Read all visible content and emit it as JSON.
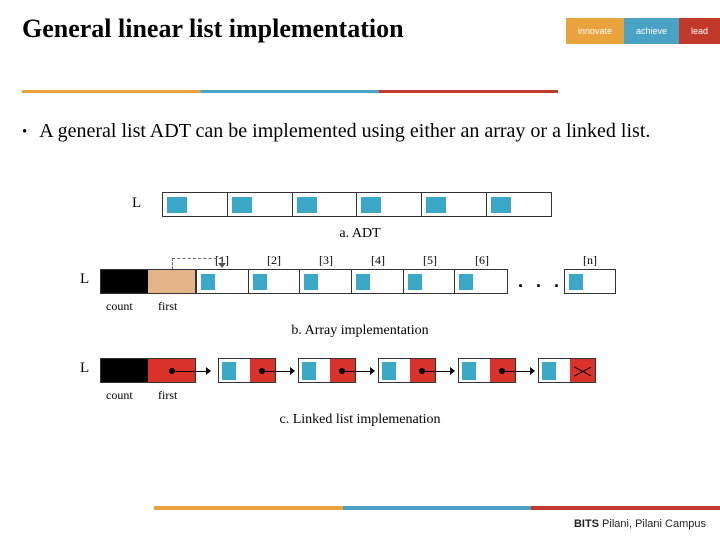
{
  "header": {
    "title": "General linear list implementation",
    "tabs": {
      "innovate": "innovate",
      "achieve": "achieve",
      "lead": "lead"
    }
  },
  "bullet": {
    "text": "A general list ADT can be implemented using either an array or a linked list."
  },
  "diagram": {
    "L": "L",
    "a_caption": "a. ADT",
    "b_caption": "b. Array implementation",
    "c_caption": "c. Linked list implemenation",
    "count": "count",
    "first": "first",
    "dots": ". . .",
    "indices": {
      "i1": "[1]",
      "i2": "[2]",
      "i3": "[3]",
      "i4": "[4]",
      "i5": "[5]",
      "i6": "[6]",
      "in": "[n]"
    }
  },
  "footer": {
    "brand": "BITS",
    "rest": " Pilani, Pilani Campus"
  }
}
